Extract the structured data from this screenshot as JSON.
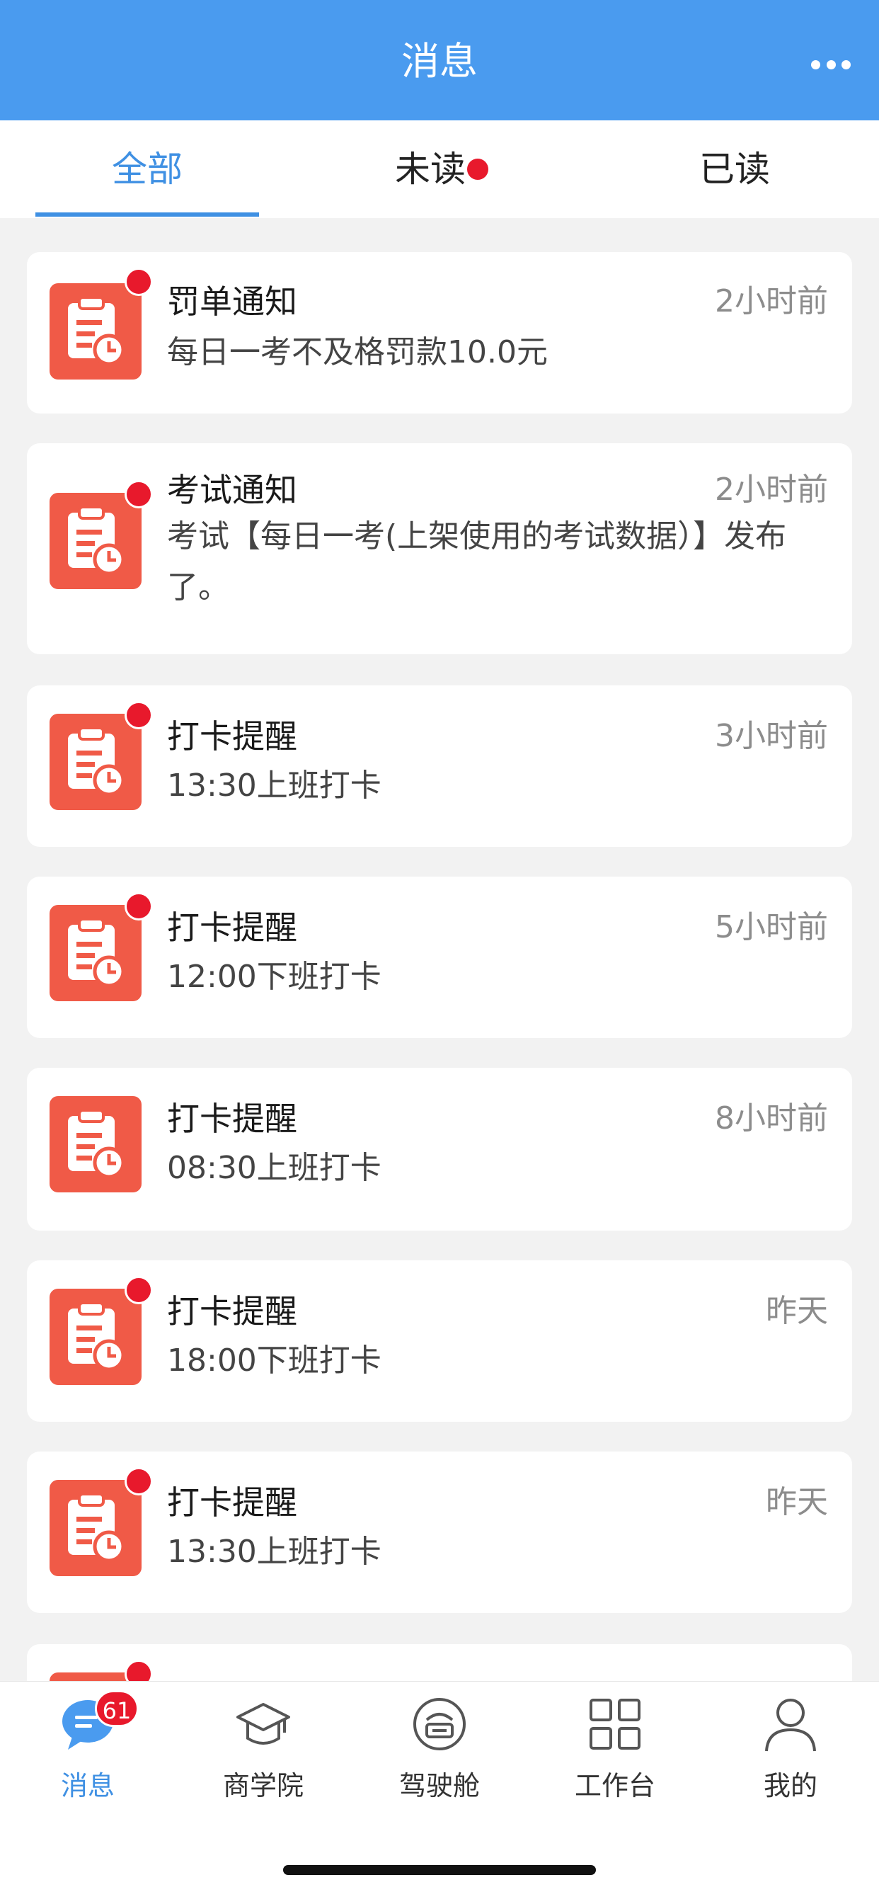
{
  "header": {
    "title": "消息",
    "more_icon": "more-dots-icon"
  },
  "tabs": [
    {
      "label": "全部",
      "active": true
    },
    {
      "label": "未读",
      "active": false,
      "dot": true
    },
    {
      "label": "已读",
      "active": false
    }
  ],
  "messages": [
    {
      "title": "罚单通知",
      "time": "2小时前",
      "body": "每日一考不及格罚款10.0元",
      "unread": true,
      "icon": "clipboard-clock-icon"
    },
    {
      "title": "考试通知",
      "time": "2小时前",
      "body": "考试【每日一考(上架使用的考试数据）】发布了。",
      "unread": true,
      "icon": "clipboard-clock-icon"
    },
    {
      "title": "打卡提醒",
      "time": "3小时前",
      "body": "13:30上班打卡",
      "unread": true,
      "icon": "clipboard-clock-icon"
    },
    {
      "title": "打卡提醒",
      "time": "5小时前",
      "body": "12:00下班打卡",
      "unread": true,
      "icon": "clipboard-clock-icon"
    },
    {
      "title": "打卡提醒",
      "time": "8小时前",
      "body": "08:30上班打卡",
      "unread": false,
      "icon": "clipboard-clock-icon"
    },
    {
      "title": "打卡提醒",
      "time": "昨天",
      "body": "18:00下班打卡",
      "unread": true,
      "icon": "clipboard-clock-icon"
    },
    {
      "title": "打卡提醒",
      "time": "昨天",
      "body": "13:30上班打卡",
      "unread": true,
      "icon": "clipboard-clock-icon"
    }
  ],
  "nav": {
    "items": [
      {
        "label": "消息",
        "icon": "message-bubble-icon",
        "active": true,
        "badge": "61"
      },
      {
        "label": "商学院",
        "icon": "graduation-cap-icon",
        "active": false
      },
      {
        "label": "驾驶舱",
        "icon": "cockpit-icon",
        "active": false
      },
      {
        "label": "工作台",
        "icon": "grid-icon",
        "active": false
      },
      {
        "label": "我的",
        "icon": "user-icon",
        "active": false
      }
    ]
  },
  "colors": {
    "primary": "#4a9bef",
    "accent_text": "#3f90e3",
    "badge_red": "#e8192c",
    "icon_red": "#f05a47"
  }
}
